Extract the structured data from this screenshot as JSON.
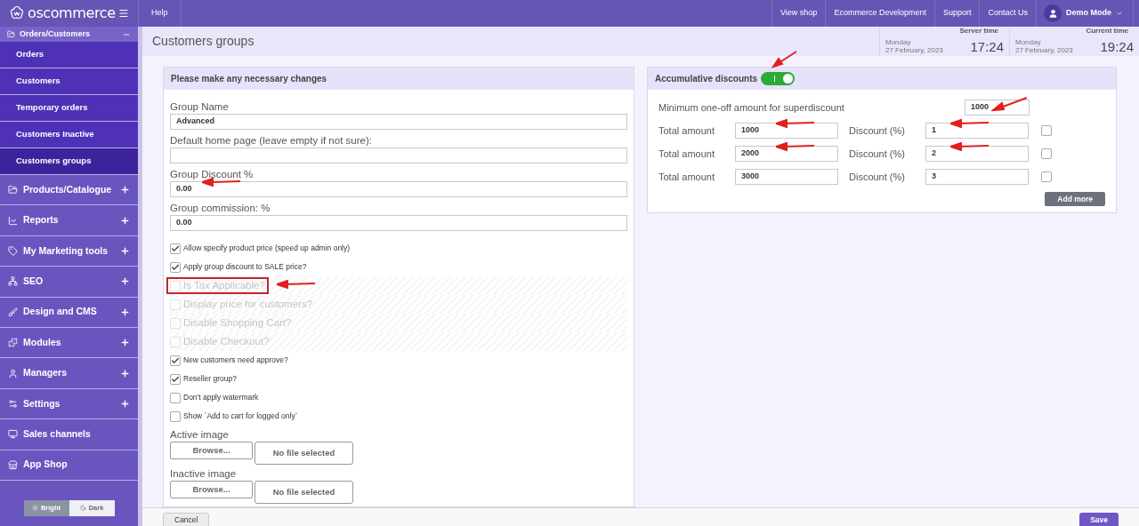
{
  "topbar": {
    "logo": "oscommerce",
    "help": "Help",
    "links": [
      "View shop",
      "Ecommerce Development",
      "Support",
      "Contact Us"
    ],
    "user": "Demo Mode"
  },
  "sidebar": {
    "section": {
      "label": "Orders/Customers",
      "expanded": true,
      "children": [
        {
          "label": "Orders",
          "selected": false
        },
        {
          "label": "Customers",
          "selected": false
        },
        {
          "label": "Temporary orders",
          "selected": false
        },
        {
          "label": "Customers Inactive",
          "selected": false
        },
        {
          "label": "Customers groups",
          "selected": true
        }
      ]
    },
    "items": [
      {
        "label": "Products/Catalogue",
        "expandable": true
      },
      {
        "label": "Reports",
        "expandable": true
      },
      {
        "label": "My Marketing tools",
        "expandable": true
      },
      {
        "label": "SEO",
        "expandable": true
      },
      {
        "label": "Design and CMS",
        "expandable": true
      },
      {
        "label": "Modules",
        "expandable": true
      },
      {
        "label": "Managers",
        "expandable": true
      },
      {
        "label": "Settings",
        "expandable": true
      },
      {
        "label": "Sales channels",
        "expandable": false
      },
      {
        "label": "App Shop",
        "expandable": false
      }
    ],
    "theme": [
      {
        "label": "Bright",
        "selected": true
      },
      {
        "label": "Dark",
        "selected": false
      }
    ]
  },
  "page": {
    "title": "Customers groups",
    "times": [
      {
        "label": "Server time",
        "day": "Monday",
        "date": "27 February, 2023",
        "time": "17:24"
      },
      {
        "label": "Current time",
        "day": "Monday",
        "date": "27 February, 2023",
        "time": "19:24"
      }
    ]
  },
  "form": {
    "title": "Please make any necessary changes",
    "fields": [
      {
        "label": "Group Name",
        "value": "Advanced",
        "annotated": false
      },
      {
        "label": "Default home page (leave empty if not sure):",
        "annotated": false
      },
      {
        "label": "Group Discount %",
        "value": "0.00",
        "annotated": true
      },
      {
        "label": "Group commission: %",
        "value": "0.00",
        "annotated": false
      }
    ],
    "checkboxes": [
      {
        "label": "Allow specify product price (speed up admin only)",
        "checked": true,
        "disabled": false,
        "annotated": false
      },
      {
        "label": "Apply group discount to SALE price?",
        "checked": true,
        "disabled": false,
        "annotated": false
      },
      {
        "label": "Is Tax Applicable?",
        "checked": false,
        "disabled": true,
        "annotated": true
      },
      {
        "label": "Display price for customers?",
        "checked": false,
        "disabled": true,
        "annotated": false
      },
      {
        "label": "Disable Shopping Cart?",
        "checked": false,
        "disabled": true,
        "annotated": false
      },
      {
        "label": "Disable Checkout?",
        "checked": false,
        "disabled": true,
        "annotated": false
      },
      {
        "label": "New customers need approve?",
        "checked": true,
        "disabled": false,
        "annotated": false
      },
      {
        "label": "Reseller group?",
        "checked": true,
        "disabled": false,
        "annotated": false
      },
      {
        "label": "Don't apply watermark",
        "checked": false,
        "disabled": false,
        "annotated": false
      },
      {
        "label": "Show `Add to cart for logged only`",
        "checked": false,
        "disabled": false,
        "annotated": false
      }
    ],
    "images": [
      {
        "label": "Active image",
        "button": "Browse...",
        "status": "No file selected"
      },
      {
        "label": "Inactive image",
        "button": "Browse...",
        "status": "No file selected"
      }
    ]
  },
  "discounts": {
    "title": "Accumulative discounts",
    "on": true,
    "toggle_annotated": true,
    "minimum": {
      "label": "Minimum one-off amount for superdiscount",
      "value": "1000",
      "annotated": true
    },
    "rows": [
      {
        "amount_label": "Total amount",
        "amount": "1000",
        "amount_annotated": true,
        "discount_label": "Discount (%)",
        "discount": "1",
        "discount_annotated": true,
        "checked": false
      },
      {
        "amount_label": "Total amount",
        "amount": "2000",
        "amount_annotated": true,
        "discount_label": "Discount (%)",
        "discount": "2",
        "discount_annotated": true,
        "checked": false
      },
      {
        "amount_label": "Total amount",
        "amount": "3000",
        "amount_annotated": false,
        "discount_label": "Discount (%)",
        "discount": "3",
        "discount_annotated": false,
        "checked": false
      }
    ],
    "add_button": "Add more"
  },
  "footer": {
    "cancel": "Cancel",
    "save": "Save"
  }
}
